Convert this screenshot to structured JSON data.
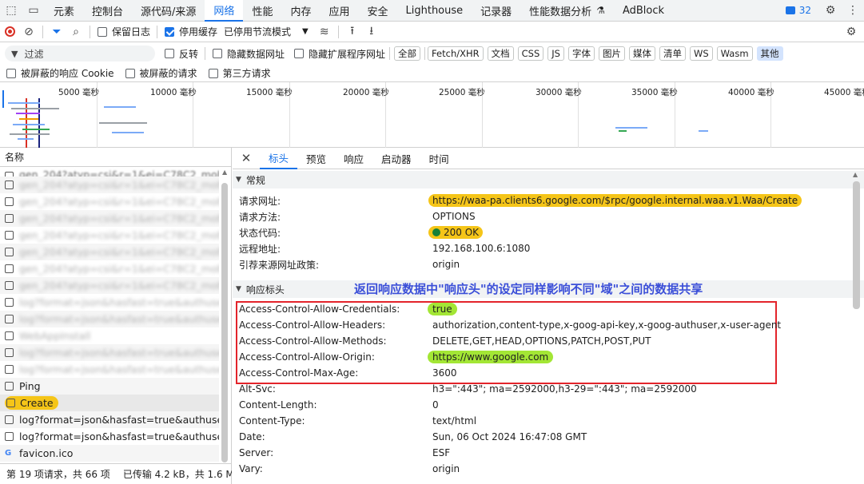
{
  "tabs": [
    {
      "label": "元素"
    },
    {
      "label": "控制台"
    },
    {
      "label": "源代码/来源"
    },
    {
      "label": "网络"
    },
    {
      "label": "性能"
    },
    {
      "label": "内存"
    },
    {
      "label": "应用"
    },
    {
      "label": "安全"
    },
    {
      "label": "Lighthouse"
    },
    {
      "label": "记录器"
    },
    {
      "label": "性能数据分析"
    },
    {
      "label": "AdBlock"
    }
  ],
  "active_tab": "网络",
  "issues_count": "32",
  "toolbar": {
    "preserve_log": "保留日志",
    "disable_cache": "停用缓存",
    "throttling": "已停用节流模式"
  },
  "filter": {
    "placeholder": "过滤",
    "invert": "反转",
    "hide_data_urls": "隐藏数据网址",
    "hide_ext_urls": "隐藏扩展程序网址",
    "types": [
      "全部",
      "Fetch/XHR",
      "文档",
      "CSS",
      "JS",
      "字体",
      "图片",
      "媒体",
      "清单",
      "WS",
      "Wasm",
      "其他"
    ],
    "selected_type": "其他"
  },
  "blocked": {
    "blocked_cookies": "被屏蔽的响应 Cookie",
    "blocked_requests": "被屏蔽的请求",
    "third_party": "第三方请求"
  },
  "overview": {
    "ticks": [
      "5000 毫秒",
      "10000 毫秒",
      "15000 毫秒",
      "20000 毫秒",
      "25000 毫秒",
      "30000 毫秒",
      "35000 毫秒",
      "40000 毫秒",
      "45000 毫秒"
    ]
  },
  "left": {
    "column_name": "名称",
    "partial_top": "gen_204?atyp=csi&r=1&ei=C78C2_moEs...",
    "blurred_rows": [
      "gen_204?atyp=csi&r=1&ei=C78C2_moEsW...",
      "gen_204?atyp=csi&r=1&ei=C78C2_moEsW...",
      "gen_204?atyp=csi&r=1&ei=C78C2_moEsW...",
      "gen_204?atyp=csi&r=1&ei=C78C2_moEsW...",
      "gen_204?atyp=csi&r=1&ei=C78C2_moEsW...",
      "gen_204?atyp=csi&r=1&ei=C78C2_moEsW...",
      "gen_204?atyp=csi&r=1&ei=C78C2_moEsW...",
      "log?format=json&hasfast=true&authuser...",
      "log?format=json&hasfast=true&authuser...",
      "WebAppInstall",
      "log?format=json&hasfast=true&authuser...",
      "log?format=json&hasfast=true&authuser..."
    ],
    "ping": "Ping",
    "create": "Create",
    "log1": "log?format=json&hasfast=true&authuse...",
    "log2": "log?format=json&hasfast=true&authuse...",
    "favicon": "favicon.ico",
    "status_requests": "第 19 项请求，共 66 项",
    "status_transferred": "已传输 4.2 kB，共 1.6 M"
  },
  "detail": {
    "tabs": [
      "标头",
      "预览",
      "响应",
      "启动器",
      "时间"
    ],
    "general_title": "常规",
    "general": [
      {
        "k": "请求网址:",
        "v": "https://waa-pa.clients6.google.com/$rpc/google.internal.waa.v1.Waa/Create"
      },
      {
        "k": "请求方法:",
        "v": "OPTIONS"
      },
      {
        "k": "状态代码:",
        "v": "200 OK"
      },
      {
        "k": "远程地址:",
        "v": "192.168.100.6:1080"
      },
      {
        "k": "引荐来源网址政策:",
        "v": "origin"
      }
    ],
    "response_title": "响应标头",
    "annotation": "返回响应数据中\"响应头\"的设定同样影响不同\"域\"之间的数据共享",
    "response": [
      {
        "k": "Access-Control-Allow-Credentials:",
        "v": "true"
      },
      {
        "k": "Access-Control-Allow-Headers:",
        "v": "authorization,content-type,x-goog-api-key,x-goog-authuser,x-user-agent"
      },
      {
        "k": "Access-Control-Allow-Methods:",
        "v": "DELETE,GET,HEAD,OPTIONS,PATCH,POST,PUT"
      },
      {
        "k": "Access-Control-Allow-Origin:",
        "v": "https://www.google.com"
      },
      {
        "k": "Access-Control-Max-Age:",
        "v": "3600"
      },
      {
        "k": "Alt-Svc:",
        "v": "h3=\":443\"; ma=2592000,h3-29=\":443\"; ma=2592000"
      },
      {
        "k": "Content-Length:",
        "v": "0"
      },
      {
        "k": "Content-Type:",
        "v": "text/html"
      },
      {
        "k": "Date:",
        "v": "Sun, 06 Oct 2024 16:47:08 GMT"
      },
      {
        "k": "Server:",
        "v": "ESF"
      },
      {
        "k": "Vary:",
        "v": "origin"
      }
    ]
  },
  "colors": {
    "accent": "#1a73e8",
    "highlight_orange": "#f5c518",
    "highlight_green": "#a3e635",
    "annotation_blue": "#3b4fd8",
    "box_red": "#e3242b"
  }
}
